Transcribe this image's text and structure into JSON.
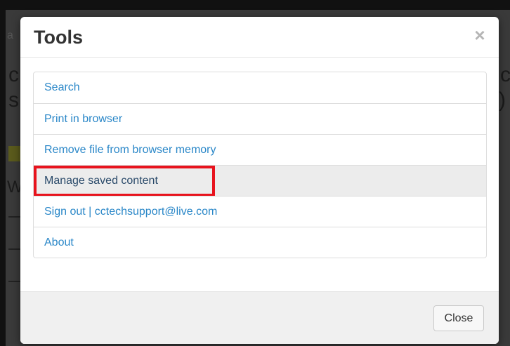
{
  "background": {
    "fragments": [
      "a",
      "c",
      "s",
      "W",
      "c",
      ")"
    ]
  },
  "modal": {
    "title": "Tools",
    "close_icon_glyph": "×",
    "items": [
      {
        "label": "Search"
      },
      {
        "label": "Print in browser"
      },
      {
        "label": "Remove file from browser memory"
      },
      {
        "label": "Manage saved content",
        "active": true,
        "highlighted": true
      },
      {
        "label": "Sign out | cctechsupport@live.com"
      },
      {
        "label": "About"
      }
    ],
    "footer": {
      "close_label": "Close"
    }
  },
  "colors": {
    "link": "#2a87c8",
    "highlight_border": "#e8131d",
    "active_row": "#ececec"
  }
}
